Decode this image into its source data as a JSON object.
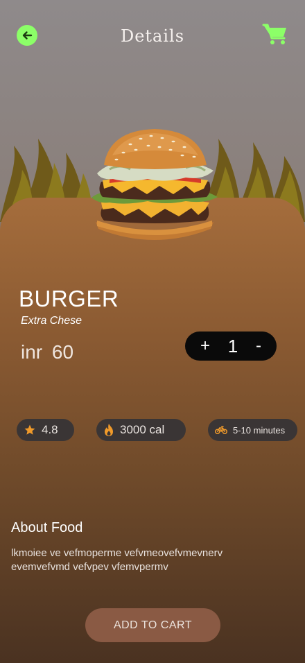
{
  "header": {
    "title": "Details",
    "back_icon": "arrow-left-icon",
    "cart_icon": "shopping-cart-icon"
  },
  "product": {
    "name": "BURGER",
    "subtitle": "Extra Chese",
    "price_currency": "inr",
    "price_value": "60",
    "image": "burger-image"
  },
  "quantity": {
    "plus_label": "+",
    "value": "1",
    "minus_label": "-"
  },
  "stats": {
    "rating": "4.8",
    "calories": "3000 cal",
    "delivery": "5-10 minutes"
  },
  "about": {
    "title": "About Food",
    "text": "lkmoiee ve vefmoperme vefvmeovefvmevnerv evemvefvmd vefvpev vfemvpermv"
  },
  "actions": {
    "add_to_cart": "ADD TO CART"
  },
  "colors": {
    "accent_green": "#8cff68",
    "pill_bg": "#3a3535",
    "button_bg": "#8a5a44",
    "star_orange": "#f09a2a"
  }
}
